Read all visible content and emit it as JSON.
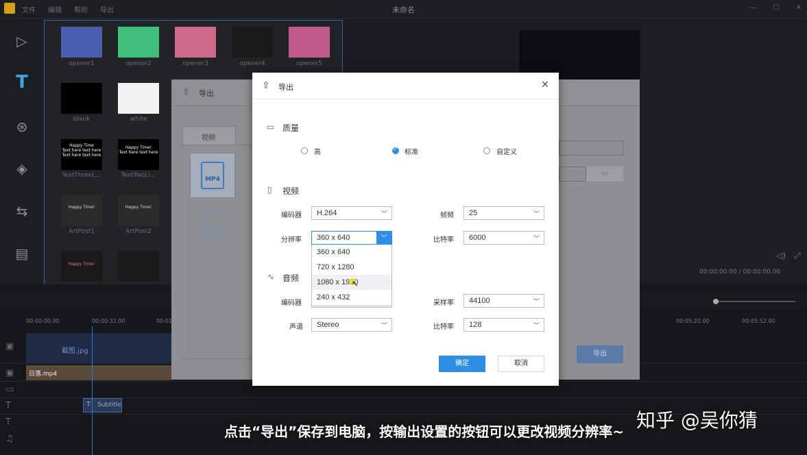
{
  "app": {
    "window_title": "未命名",
    "menu": [
      "文件",
      "编辑",
      "帮助",
      "导出"
    ]
  },
  "library": {
    "items": [
      {
        "label": "opener1",
        "color": "#4a5fb0"
      },
      {
        "label": "opener2",
        "color": "#3fbf7a"
      },
      {
        "label": "opener3",
        "color": "#d06a8a"
      },
      {
        "label": "opener4",
        "color": "#1a1a1a"
      },
      {
        "label": "opener5",
        "color": "#c05a8a"
      },
      {
        "label": "blank",
        "color": "#000000"
      },
      {
        "label": "white",
        "color": "#f2f2f2"
      },
      {
        "label": "TextThreeL...",
        "color": "#000000",
        "text": "Happy Time\nText here text here\nText here text here"
      },
      {
        "label": "TextTwoLi...",
        "color": "#000000",
        "text": "Happy Time!\nText here text here"
      },
      {
        "label": "ArtPost1",
        "color": "#2a2a2a",
        "text": "Happy Time!"
      },
      {
        "label": "ArtPost2",
        "color": "#2a2a2a",
        "text": "Happy Time!"
      },
      {
        "label": "",
        "color": "#1a1a1a",
        "text": "Happy Time!"
      },
      {
        "label": "",
        "color": "#1a1a1a"
      }
    ]
  },
  "preview": {
    "timecode": "00:00:00.00 / 00:00:00.00"
  },
  "timeline": {
    "ticks": [
      "00:00:00.00",
      "00:00:32.00",
      "00:01",
      "00:05:20.00",
      "00:05:52.00"
    ],
    "clips": {
      "image": "截图.jpg",
      "video": "日落.mp4",
      "subtitle": "Subtitle"
    }
  },
  "bg_dialog": {
    "title": "导出",
    "tab": "视频",
    "formats": [
      "MP4",
      "MKV"
    ],
    "export_button": "导出"
  },
  "dialog": {
    "title": "导出",
    "quality": {
      "title": "质量",
      "options": [
        "高",
        "标准",
        "自定义"
      ],
      "selected": "标准"
    },
    "video": {
      "title": "视频",
      "encoder_label": "编码器",
      "encoder_value": "H.264",
      "fps_label": "帧频",
      "fps_value": "25",
      "resolution_label": "分辨率",
      "resolution_value": "360 x 640",
      "bitrate_label": "比特率",
      "bitrate_value": "6000",
      "resolution_options": [
        "360 x 640",
        "720 x 1280",
        "1080 x 1920",
        "240 x 432"
      ]
    },
    "audio": {
      "title": "音频",
      "encoder_label": "编码器",
      "samplerate_label": "采样率",
      "samplerate_value": "44100",
      "channel_label": "声道",
      "channel_value": "Stereo",
      "bitrate_label": "比特率",
      "bitrate_value": "128"
    },
    "ok": "确定",
    "cancel": "取消"
  },
  "overlay": {
    "caption": "点击“导出”保存到电脑，按输出设置的按钮可以更改视频分辨率~",
    "watermark": "知乎 @吴你猜"
  }
}
